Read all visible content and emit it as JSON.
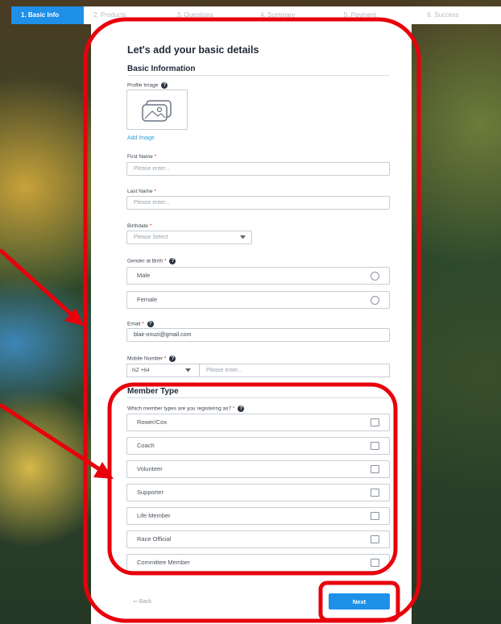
{
  "steps": [
    {
      "label": "1. Basic Info",
      "active": true
    },
    {
      "label": "2. Products",
      "active": false
    },
    {
      "label": "3. Questions",
      "active": false
    },
    {
      "label": "4. Summary",
      "active": false
    },
    {
      "label": "5. Payment",
      "active": false
    },
    {
      "label": "6. Success",
      "active": false
    }
  ],
  "form": {
    "title": "Let's add your basic details",
    "basic_section": "Basic Information",
    "profile_label": "Profile Image",
    "add_image": "Add Image",
    "first_name": {
      "label": "First Name",
      "placeholder": "Please enter..."
    },
    "last_name": {
      "label": "Last Name",
      "placeholder": "Please enter..."
    },
    "birthdate": {
      "label": "Birthdate",
      "placeholder": "Please Select"
    },
    "gender": {
      "label": "Gender at Birth",
      "options": [
        "Male",
        "Female"
      ]
    },
    "email": {
      "label": "Email",
      "value": "blair-onuzi@gmail.com"
    },
    "mobile": {
      "label": "Mobile Number",
      "code": "NZ  +64",
      "placeholder": "Please enter..."
    },
    "member_section": "Member Type",
    "member_question": "Which member types are you registering as?",
    "member_types": [
      "Rower/Cox",
      "Coach",
      "Volunteer",
      "Supporter",
      "Life Member",
      "Race Official",
      "Committee Member"
    ],
    "required_mark": "*",
    "help_mark": "?",
    "back": "Back",
    "next": "Next"
  },
  "icons": {
    "profile_placeholder": "image-placeholder-icon",
    "dropdown": "chevron-down-icon",
    "back_arrow": "arrow-left-icon"
  },
  "colors": {
    "accent": "#1e90e8",
    "annotation": "#e8000b",
    "link": "#2a9fd6"
  }
}
